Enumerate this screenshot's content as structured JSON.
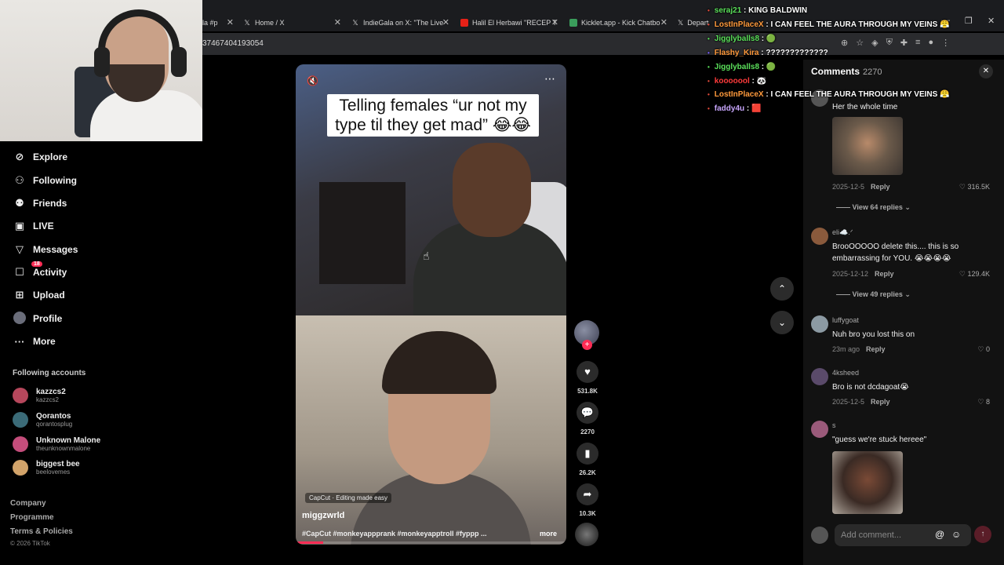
{
  "browser": {
    "tabs": [
      {
        "label": "la #p",
        "icon": "globe-icon"
      },
      {
        "label": "Home / X",
        "icon": "x-icon"
      },
      {
        "label": "IndieGala on X: \"The Live",
        "icon": "x-icon"
      },
      {
        "label": "Halil El Herbawi \"RECEP T",
        "icon": "youtube-icon"
      },
      {
        "label": "Kicklet.app - Kick Chatbo",
        "icon": "kicklet-icon"
      },
      {
        "label": "Department of War",
        "icon": "x-icon"
      }
    ],
    "url_fragment": "37467404193054"
  },
  "sidebar": {
    "items": [
      {
        "label": "Explore",
        "icon": "compass-icon"
      },
      {
        "label": "Following",
        "icon": "person-icon"
      },
      {
        "label": "Friends",
        "icon": "friends-icon"
      },
      {
        "label": "LIVE",
        "icon": "live-icon"
      },
      {
        "label": "Messages",
        "icon": "messages-icon"
      },
      {
        "label": "Activity",
        "icon": "activity-icon",
        "badge": "18"
      },
      {
        "label": "Upload",
        "icon": "upload-icon"
      },
      {
        "label": "Profile",
        "icon": "profile-avatar"
      },
      {
        "label": "More",
        "icon": "more-icon"
      }
    ],
    "following_title": "Following accounts",
    "accounts": [
      {
        "name": "kazzcs2",
        "handle": "kazzcs2",
        "color": "#b6475c"
      },
      {
        "name": "Qorantos",
        "handle": "qorantosplug",
        "color": "#3b6b78"
      },
      {
        "name": "Unknown Malone",
        "handle": "theunknownmalone",
        "color": "#c44d7b"
      },
      {
        "name": "biggest bee",
        "handle": "beelovemes",
        "color": "#d2a36a"
      }
    ],
    "footer": [
      "Company",
      "Programme",
      "Terms & Policies"
    ],
    "copyright": "© 2026 TikTok"
  },
  "video": {
    "caption": "Telling females “ur not my type til they get mad” 😂😂",
    "capcut_label": "CapCut · Editing made easy",
    "author": "miggzwrld",
    "hashtags": "#CapCut #monkeyappprank #monkeyapptroll #fyppp ...",
    "more_label": "more",
    "progress_fraction": 0.1
  },
  "actions": {
    "likes": "531.8K",
    "comments": "2270",
    "saves": "26.2K",
    "shares": "10.3K"
  },
  "chat": [
    {
      "user": "seraj21",
      "msg": "KING BALDWIN",
      "color": "#5be05b",
      "dot": "#e74c3c"
    },
    {
      "user": "LostInPlaceX",
      "msg": "I CAN FEEL THE AURA THROUGH MY VEINS 😤",
      "color": "#ff9a3c",
      "dot": "#e74c3c"
    },
    {
      "user": "Jigglyballs8",
      "msg": "🟢",
      "color": "#5be05b",
      "dot": "#5be05b"
    },
    {
      "user": "Flashy_Kira",
      "msg": "?????????????",
      "color": "#ff9a3c",
      "dot": "#7b61ff"
    },
    {
      "user": "Jigglyballs8",
      "msg": "🟢",
      "color": "#5be05b",
      "dot": "#5be05b"
    },
    {
      "user": "kooooool",
      "msg": "🐼",
      "color": "#ff3b3b",
      "dot": "#e74c3c"
    },
    {
      "user": "LostInPlaceX",
      "msg": "I CAN FEEL THE AURA THROUGH MY VEINS 😤",
      "color": "#ff9a3c",
      "dot": "#e74c3c"
    },
    {
      "user": "faddy4u",
      "msg": "🟥",
      "color": "#c9a7ff",
      "dot": "#e74c3c"
    }
  ],
  "comments": {
    "title": "Comments",
    "count": "2270",
    "items": [
      {
        "user": "",
        "text": "Her the whole time",
        "date": "2025-12-5",
        "reply": "Reply",
        "likes": "316.5K",
        "replies_label": "View 64 replies"
      },
      {
        "user": "eli☁️.ᐟ",
        "text": "BrooOOOOO delete this.... this is so embarrassing for YOU. 😭😭😭😭",
        "date": "2025-12-12",
        "reply": "Reply",
        "likes": "129.4K",
        "replies_label": "View 49 replies"
      },
      {
        "user": "luffygoat",
        "text": "Nuh bro you lost this on",
        "date": "23m ago",
        "reply": "Reply",
        "likes": "0"
      },
      {
        "user": "4ksheed",
        "text": "Bro is not dcdagoat😭",
        "date": "2025-12-5",
        "reply": "Reply",
        "likes": "8"
      },
      {
        "user": "s",
        "text": "\"guess we're stuck hereee\""
      }
    ],
    "input_placeholder": "Add comment..."
  }
}
